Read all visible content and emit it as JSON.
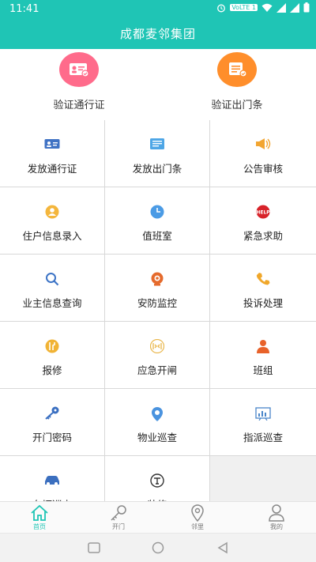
{
  "status": {
    "time": "11:41",
    "network": "VoLTE 1"
  },
  "app": {
    "title": "成都麦邻集团"
  },
  "quick_actions": [
    {
      "label": "验证通行证",
      "icon": "pass-card-icon",
      "color": "#ff5f7f"
    },
    {
      "label": "验证出门条",
      "icon": "exit-slip-icon",
      "color": "#ff8a22"
    }
  ],
  "grid": [
    {
      "label": "发放通行证",
      "icon": "id-card-icon"
    },
    {
      "label": "发放出门条",
      "icon": "document-icon"
    },
    {
      "label": "公告审核",
      "icon": "megaphone-icon"
    },
    {
      "label": "住户信息录入",
      "icon": "resident-icon"
    },
    {
      "label": "值班室",
      "icon": "clock-icon"
    },
    {
      "label": "紧急求助",
      "icon": "help-icon"
    },
    {
      "label": "业主信息查询",
      "icon": "search-icon"
    },
    {
      "label": "安防监控",
      "icon": "camera-icon"
    },
    {
      "label": "投诉处理",
      "icon": "phone-icon"
    },
    {
      "label": "报修",
      "icon": "repair-icon"
    },
    {
      "label": "应急开闸",
      "icon": "gate-icon"
    },
    {
      "label": "班组",
      "icon": "person-icon"
    },
    {
      "label": "开门密码",
      "icon": "key-icon"
    },
    {
      "label": "物业巡查",
      "icon": "patrol-pin-icon"
    },
    {
      "label": "指派巡查",
      "icon": "chart-board-icon"
    },
    {
      "label": "车辆巡查",
      "icon": "car-icon"
    },
    {
      "label": "装修",
      "icon": "tools-icon"
    }
  ],
  "tabs": [
    {
      "label": "首页",
      "icon": "home-icon",
      "active": true
    },
    {
      "label": "开门",
      "icon": "key-icon",
      "active": false
    },
    {
      "label": "邻里",
      "icon": "location-icon",
      "active": false
    },
    {
      "label": "我的",
      "icon": "user-icon",
      "active": false
    }
  ],
  "colors": {
    "primary": "#1fc5b5"
  }
}
